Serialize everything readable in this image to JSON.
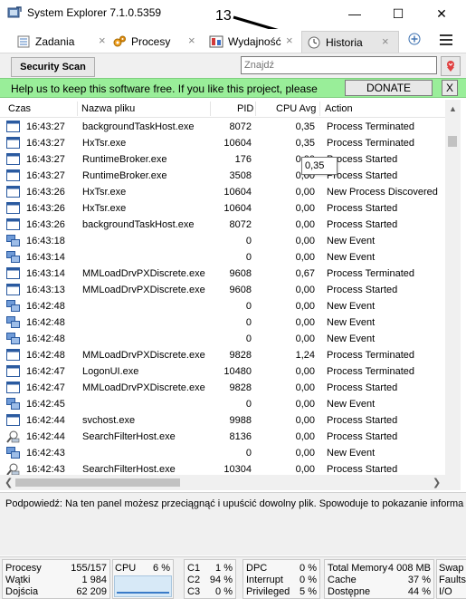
{
  "window": {
    "title": "System Explorer 7.1.0.5359",
    "minimize_glyph": "—",
    "maximize_glyph": "☐",
    "close_glyph": "✕"
  },
  "annotation": {
    "label": "13"
  },
  "tabs": [
    {
      "label": "Zadania",
      "icon": "tasks-icon"
    },
    {
      "label": "Procesy",
      "icon": "gears-icon"
    },
    {
      "label": "Wydajność",
      "icon": "performance-icon"
    },
    {
      "label": "Historia",
      "icon": "clock-icon",
      "active": true
    }
  ],
  "toolbar": {
    "security_scan_label": "Security Scan",
    "search_placeholder": "Znajdź"
  },
  "banner": {
    "text": "Help us to keep this software free.  If you like this project, please",
    "donate_label": "DONATE",
    "close_label": "X",
    "color": "#99ee99"
  },
  "grid": {
    "columns": {
      "time": "Czas",
      "name": "Nazwa pliku",
      "pid": "PID",
      "cpu": "CPU Avg",
      "action": "Action"
    },
    "rows": [
      {
        "icon": "window",
        "time": "16:43:27",
        "name": "backgroundTaskHost.exe",
        "pid": "8072",
        "cpu": "0,35",
        "action": "Process Terminated"
      },
      {
        "icon": "window",
        "time": "16:43:27",
        "name": "HxTsr.exe",
        "pid": "10604",
        "cpu": "0,35",
        "action": "Process Terminated"
      },
      {
        "icon": "window",
        "time": "16:43:27",
        "name": "RuntimeBroker.exe",
        "pid": "176",
        "cpu": "0,00",
        "action": "Process Started"
      },
      {
        "icon": "window",
        "time": "16:43:27",
        "name": "RuntimeBroker.exe",
        "pid": "3508",
        "cpu": "0,00",
        "action": "Process Started"
      },
      {
        "icon": "window",
        "time": "16:43:26",
        "name": "HxTsr.exe",
        "pid": "10604",
        "cpu": "0,00",
        "action": "New Process Discovered"
      },
      {
        "icon": "window",
        "time": "16:43:26",
        "name": "HxTsr.exe",
        "pid": "10604",
        "cpu": "0,00",
        "action": "Process Started"
      },
      {
        "icon": "window",
        "time": "16:43:26",
        "name": "backgroundTaskHost.exe",
        "pid": "8072",
        "cpu": "0,00",
        "action": "Process Started"
      },
      {
        "icon": "event",
        "time": "16:43:18",
        "name": "",
        "pid": "0",
        "cpu": "0,00",
        "action": "New Event"
      },
      {
        "icon": "event",
        "time": "16:43:14",
        "name": "",
        "pid": "0",
        "cpu": "0,00",
        "action": "New Event"
      },
      {
        "icon": "window",
        "time": "16:43:14",
        "name": "MMLoadDrvPXDiscrete.exe",
        "pid": "9608",
        "cpu": "0,67",
        "action": "Process Terminated"
      },
      {
        "icon": "window",
        "time": "16:43:13",
        "name": "MMLoadDrvPXDiscrete.exe",
        "pid": "9608",
        "cpu": "0,00",
        "action": "Process Started"
      },
      {
        "icon": "event",
        "time": "16:42:48",
        "name": "",
        "pid": "0",
        "cpu": "0,00",
        "action": "New Event"
      },
      {
        "icon": "event",
        "time": "16:42:48",
        "name": "",
        "pid": "0",
        "cpu": "0,00",
        "action": "New Event"
      },
      {
        "icon": "event",
        "time": "16:42:48",
        "name": "",
        "pid": "0",
        "cpu": "0,00",
        "action": "New Event"
      },
      {
        "icon": "window",
        "time": "16:42:48",
        "name": "MMLoadDrvPXDiscrete.exe",
        "pid": "9828",
        "cpu": "1,24",
        "action": "Process Terminated"
      },
      {
        "icon": "window",
        "time": "16:42:47",
        "name": "LogonUI.exe",
        "pid": "10480",
        "cpu": "0,00",
        "action": "Process Terminated"
      },
      {
        "icon": "window",
        "time": "16:42:47",
        "name": "MMLoadDrvPXDiscrete.exe",
        "pid": "9828",
        "cpu": "0,00",
        "action": "Process Started"
      },
      {
        "icon": "event",
        "time": "16:42:45",
        "name": "",
        "pid": "0",
        "cpu": "0,00",
        "action": "New Event"
      },
      {
        "icon": "window",
        "time": "16:42:44",
        "name": "svchost.exe",
        "pid": "9988",
        "cpu": "0,00",
        "action": "Process Started"
      },
      {
        "icon": "search",
        "time": "16:42:44",
        "name": "SearchFilterHost.exe",
        "pid": "8136",
        "cpu": "0,00",
        "action": "Process Started"
      },
      {
        "icon": "event",
        "time": "16:42:43",
        "name": "",
        "pid": "0",
        "cpu": "0,00",
        "action": "New Event"
      },
      {
        "icon": "search",
        "time": "16:42:43",
        "name": "SearchFilterHost.exe",
        "pid": "10304",
        "cpu": "0,00",
        "action": "Process Started"
      }
    ]
  },
  "tooltip": {
    "text": "0,35"
  },
  "hint": {
    "text": "Podpowiedź: Na ten panel możesz przeciągnąć i upuścić dowolny plik. Spowoduje to pokazanie informa"
  },
  "statusbar": {
    "procesy_label": "Procesy",
    "procesy_value": "155/157",
    "watki_label": "Wątki",
    "watki_value": "1 984",
    "dojscia_label": "Dojścia",
    "dojscia_value": "62 209",
    "cpu_label": "CPU",
    "cpu_value": "6 %",
    "c1_label": "C1",
    "c1_value": "1 %",
    "c2_label": "C2",
    "c2_value": "94 %",
    "c3_label": "C3",
    "c3_value": "0 %",
    "dpc_label": "DPC",
    "dpc_value": "0 %",
    "interrupt_label": "Interrupt",
    "interrupt_value": "0 %",
    "privileged_label": "Privileged",
    "privileged_value": "5 %",
    "total_memory_label": "Total Memory",
    "total_memory_value": "4 008 MB",
    "cache_label": "Cache",
    "cache_value": "37 %",
    "dostepne_label": "Dostępne",
    "dostepne_value": "44 %",
    "swap_label": "Swap",
    "faults_label": "Faults",
    "io_label": "I/O"
  }
}
